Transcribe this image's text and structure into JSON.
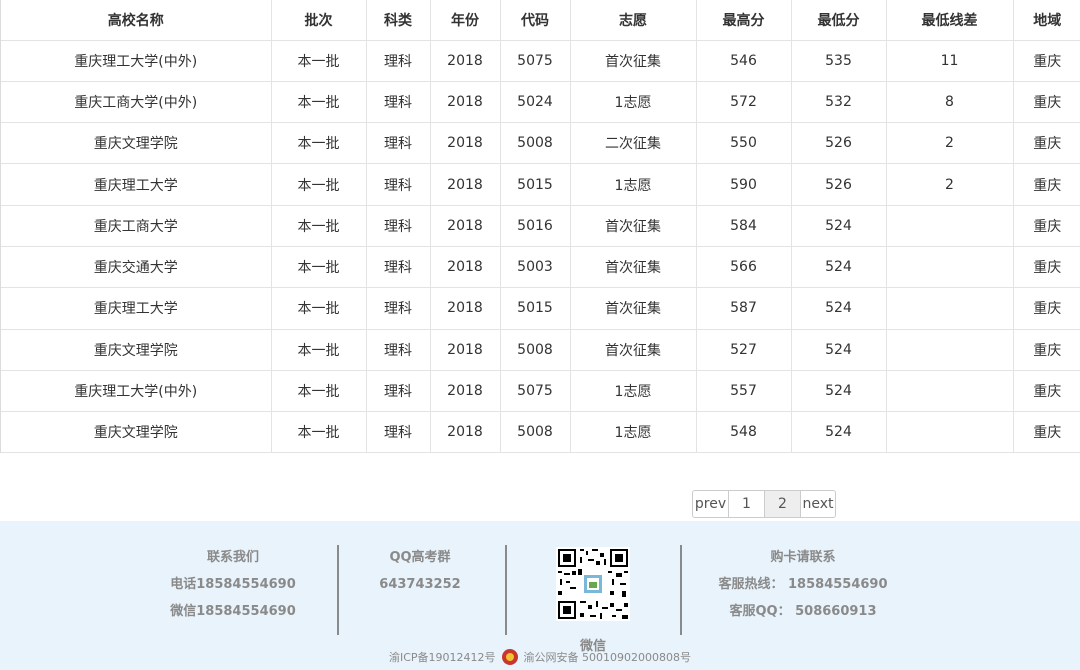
{
  "table": {
    "headers": [
      "高校名称",
      "批次",
      "科类",
      "年份",
      "代码",
      "志愿",
      "最高分",
      "最低分",
      "最低线差",
      "地域"
    ],
    "rows": [
      [
        "重庆理工大学(中外)",
        "本一批",
        "理科",
        "2018",
        "5075",
        "首次征集",
        "546",
        "535",
        "11",
        "重庆"
      ],
      [
        "重庆工商大学(中外)",
        "本一批",
        "理科",
        "2018",
        "5024",
        "1志愿",
        "572",
        "532",
        "8",
        "重庆"
      ],
      [
        "重庆文理学院",
        "本一批",
        "理科",
        "2018",
        "5008",
        "二次征集",
        "550",
        "526",
        "2",
        "重庆"
      ],
      [
        "重庆理工大学",
        "本一批",
        "理科",
        "2018",
        "5015",
        "1志愿",
        "590",
        "526",
        "2",
        "重庆"
      ],
      [
        "重庆工商大学",
        "本一批",
        "理科",
        "2018",
        "5016",
        "首次征集",
        "584",
        "524",
        "",
        "重庆"
      ],
      [
        "重庆交通大学",
        "本一批",
        "理科",
        "2018",
        "5003",
        "首次征集",
        "566",
        "524",
        "",
        "重庆"
      ],
      [
        "重庆理工大学",
        "本一批",
        "理科",
        "2018",
        "5015",
        "首次征集",
        "587",
        "524",
        "",
        "重庆"
      ],
      [
        "重庆文理学院",
        "本一批",
        "理科",
        "2018",
        "5008",
        "首次征集",
        "527",
        "524",
        "",
        "重庆"
      ],
      [
        "重庆理工大学(中外)",
        "本一批",
        "理科",
        "2018",
        "5075",
        "1志愿",
        "557",
        "524",
        "",
        "重庆"
      ],
      [
        "重庆文理学院",
        "本一批",
        "理科",
        "2018",
        "5008",
        "1志愿",
        "548",
        "524",
        "",
        "重庆"
      ]
    ]
  },
  "pager": {
    "prev": "prev",
    "pages": [
      "1",
      "2"
    ],
    "current": "2",
    "next": "next"
  },
  "footer": {
    "contact": {
      "title": "联系我们",
      "phone": "电话18584554690",
      "wechat": "微信18584554690"
    },
    "qq_group": {
      "title": "QQ高考群",
      "number": "643743252"
    },
    "qr": {
      "caption": "微信",
      "icon": "qr-code-icon"
    },
    "card": {
      "title": "购卡请联系",
      "hotline": "客服热线： 18584554690",
      "qq": "客服QQ： 508660913"
    },
    "icp": "渝ICP备19012412号",
    "police": "渝公网安备 50010902000808号"
  }
}
